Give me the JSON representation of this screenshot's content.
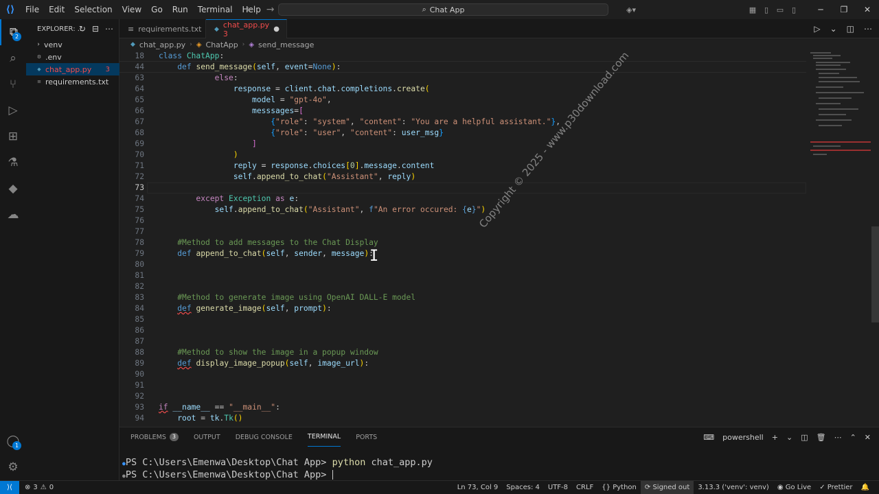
{
  "menu": [
    "File",
    "Edit",
    "Selection",
    "View",
    "Go",
    "Run",
    "Terminal",
    "Help"
  ],
  "command_center": {
    "label": "Chat App"
  },
  "sidebar": {
    "title": "EXPLORER: ...",
    "items": [
      {
        "label": "venv",
        "type": "folder"
      },
      {
        "label": ".env",
        "type": "file"
      },
      {
        "label": "chat_app.py",
        "type": "file",
        "errors": "3"
      },
      {
        "label": "requirements.txt",
        "type": "file"
      }
    ]
  },
  "activity": {
    "explorer_badge": "2",
    "account_badge": "1"
  },
  "tabs": [
    {
      "label": "requirements.txt",
      "modified": "●"
    },
    {
      "label": "chat_app.py 3",
      "modified": "●"
    }
  ],
  "breadcrumbs": [
    "chat_app.py",
    "ChatApp",
    "send_message"
  ],
  "code": {
    "l18": "18",
    "l44": "44",
    "l63": "63",
    "l64": "64",
    "l65": "65",
    "l66": "66",
    "l67": "67",
    "l68": "68",
    "l69": "69",
    "l70": "70",
    "l71": "71",
    "l72": "72",
    "l73": "73",
    "l74": "74",
    "l75": "75",
    "l76": "76",
    "l77": "77",
    "l78": "78",
    "l79": "79",
    "l80": "80",
    "l81": "81",
    "l82": "82",
    "l83": "83",
    "l84": "84",
    "l85": "85",
    "l86": "86",
    "l87": "87",
    "l88": "88",
    "l89": "89",
    "l90": "90",
    "l91": "91",
    "l92": "92",
    "l93": "93",
    "l94": "94"
  },
  "watermark": "Copyright © 2025 - www.p30download.com",
  "panel": {
    "tabs": [
      "PROBLEMS",
      "OUTPUT",
      "DEBUG CONSOLE",
      "TERMINAL",
      "PORTS"
    ],
    "problems_count": "3",
    "shell": "powershell",
    "prompt1": "PS C:\\Users\\Emenwa\\Desktop\\Chat App> ",
    "cmd1": "python",
    "cmd1_arg": " chat_app.py",
    "prompt2": "PS C:\\Users\\Emenwa\\Desktop\\Chat App> "
  },
  "status": {
    "errors": "3",
    "warnings": "0",
    "position": "Ln 73, Col 9",
    "spaces": "Spaces: 4",
    "encoding": "UTF-8",
    "eol": "CRLF",
    "language": "Python",
    "account": "Signed out",
    "interpreter": "3.13.3 ('venv': venv)",
    "golive": "Go Live",
    "prettier": "Prettier"
  }
}
